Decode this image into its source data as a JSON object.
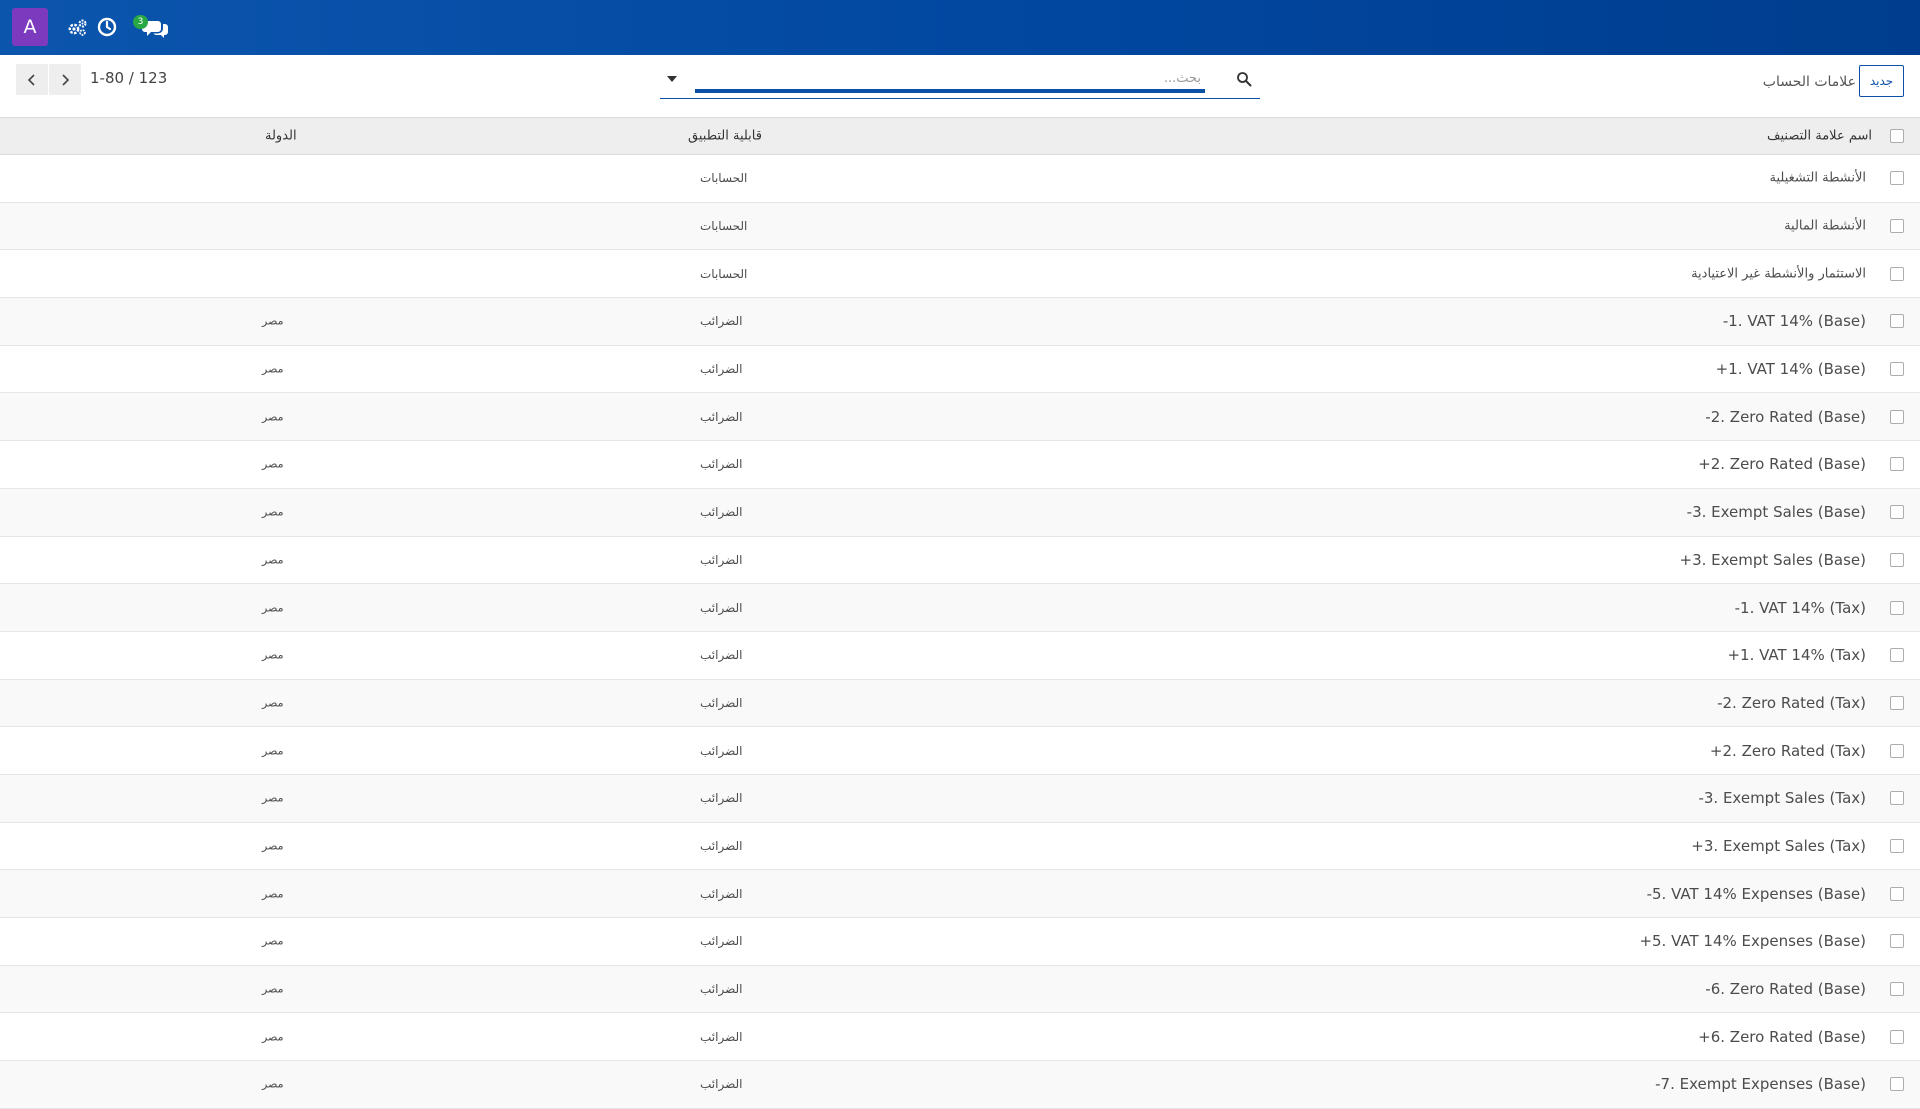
{
  "navbar": {
    "avatar_letter": "A",
    "messages_badge": "3",
    "icons": [
      "gears-icon",
      "clock-icon",
      "chat-icon"
    ],
    "bg_color": "#0147a0"
  },
  "pager": {
    "range": "1-80 / 123"
  },
  "search": {
    "placeholder": "بحث..."
  },
  "header": {
    "breadcrumb": "علامات الحساب",
    "new_label": "جديد"
  },
  "table": {
    "columns": {
      "name": "اسم علامة التصنيف",
      "applicability": "قابلية التطبيق",
      "country": "الدولة"
    },
    "rows": [
      {
        "name": "الأنشطة التشغيلية",
        "applicability": "الحسابات",
        "country": ""
      },
      {
        "name": "الأنشطة المالية",
        "applicability": "الحسابات",
        "country": ""
      },
      {
        "name": "الاستثمار والأنشطة غير الاعتيادية",
        "applicability": "الحسابات",
        "country": ""
      },
      {
        "name": "-1. VAT 14% (Base)",
        "applicability": "الضرائب",
        "country": "مصر"
      },
      {
        "name": "+1. VAT 14% (Base)",
        "applicability": "الضرائب",
        "country": "مصر"
      },
      {
        "name": "-2. Zero Rated (Base)",
        "applicability": "الضرائب",
        "country": "مصر"
      },
      {
        "name": "+2. Zero Rated (Base)",
        "applicability": "الضرائب",
        "country": "مصر"
      },
      {
        "name": "-3. Exempt Sales (Base)",
        "applicability": "الضرائب",
        "country": "مصر"
      },
      {
        "name": "+3. Exempt Sales (Base)",
        "applicability": "الضرائب",
        "country": "مصر"
      },
      {
        "name": "-1. VAT 14% (Tax)",
        "applicability": "الضرائب",
        "country": "مصر"
      },
      {
        "name": "+1. VAT 14% (Tax)",
        "applicability": "الضرائب",
        "country": "مصر"
      },
      {
        "name": "-2. Zero Rated (Tax)",
        "applicability": "الضرائب",
        "country": "مصر"
      },
      {
        "name": "+2. Zero Rated (Tax)",
        "applicability": "الضرائب",
        "country": "مصر"
      },
      {
        "name": "-3. Exempt Sales (Tax)",
        "applicability": "الضرائب",
        "country": "مصر"
      },
      {
        "name": "+3. Exempt Sales (Tax)",
        "applicability": "الضرائب",
        "country": "مصر"
      },
      {
        "name": "-5. VAT 14% Expenses (Base)",
        "applicability": "الضرائب",
        "country": "مصر"
      },
      {
        "name": "+5. VAT 14% Expenses (Base)",
        "applicability": "الضرائب",
        "country": "مصر"
      },
      {
        "name": "-6. Zero Rated (Base)",
        "applicability": "الضرائب",
        "country": "مصر"
      },
      {
        "name": "+6. Zero Rated (Base)",
        "applicability": "الضرائب",
        "country": "مصر"
      },
      {
        "name": "-7. Exempt Expenses (Base)",
        "applicability": "الضرائب",
        "country": "مصر"
      }
    ]
  }
}
